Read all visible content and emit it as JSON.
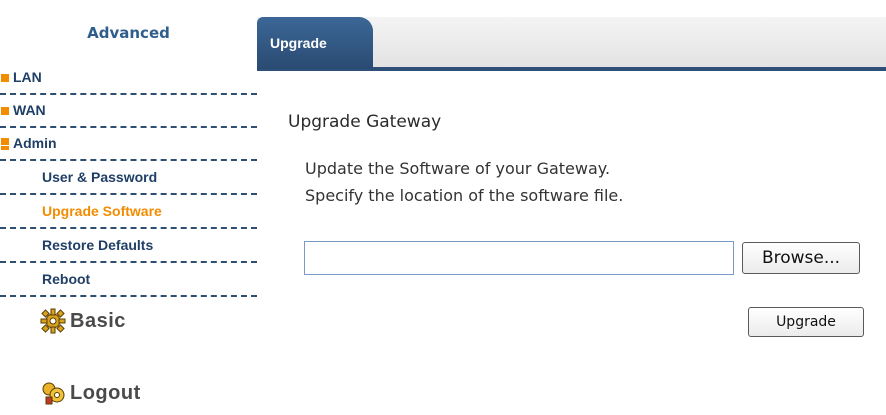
{
  "sidebar": {
    "title": "Advanced",
    "items": [
      {
        "label": "LAN"
      },
      {
        "label": "WAN"
      },
      {
        "label": "Admin"
      },
      {
        "label": "User & Password"
      },
      {
        "label": "Upgrade Software"
      },
      {
        "label": "Restore Defaults"
      },
      {
        "label": "Reboot"
      }
    ],
    "links": [
      {
        "label": "Basic",
        "icon": "gear-icon"
      },
      {
        "label": "Logout",
        "icon": "logout-icon"
      }
    ]
  },
  "tabs": [
    {
      "label": "Upgrade"
    }
  ],
  "main": {
    "heading": "Upgrade Gateway",
    "desc_line1": "Update the Software of your Gateway.",
    "desc_line2": "Specify the location of the software file.",
    "file_value": "",
    "browse_label": "Browse...",
    "upgrade_label": "Upgrade"
  },
  "colors": {
    "accent_orange": "#f28c00",
    "nav_blue": "#1f3f66",
    "tab_blue": "#2d4f78"
  }
}
